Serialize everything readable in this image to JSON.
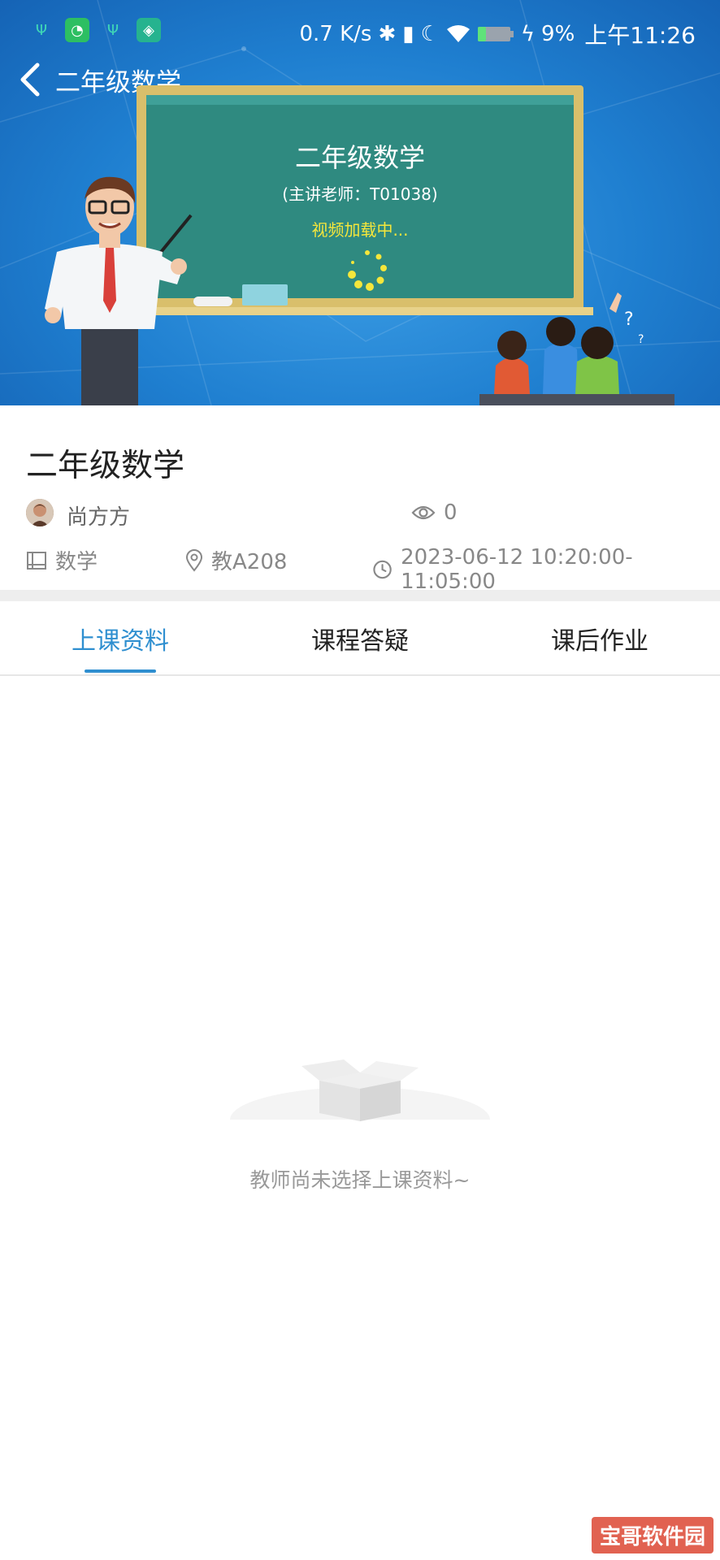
{
  "status_bar": {
    "net_speed": "0.7 K/s",
    "battery": "9%",
    "time": "上午11:26"
  },
  "header": {
    "title": "二年级数学"
  },
  "video": {
    "board_title": "二年级数学",
    "teacher_line": "(主讲老师：T01038)",
    "loading_text": "视频加载中..."
  },
  "lesson": {
    "title": "二年级数学",
    "teacher": "尚方方",
    "views": "0",
    "subject": "数学",
    "room": "教A208",
    "time": "2023-06-12 10:20:00-11:05:00"
  },
  "tabs": [
    {
      "label": "上课资料",
      "active": true
    },
    {
      "label": "课程答疑",
      "active": false
    },
    {
      "label": "课后作业",
      "active": false
    }
  ],
  "empty_state": {
    "message": "教师尚未选择上课资料~"
  },
  "watermark": "宝哥软件园",
  "colors": {
    "accent": "#2f8fd0",
    "board": "#2f8a80",
    "loading": "#f5e63b"
  }
}
